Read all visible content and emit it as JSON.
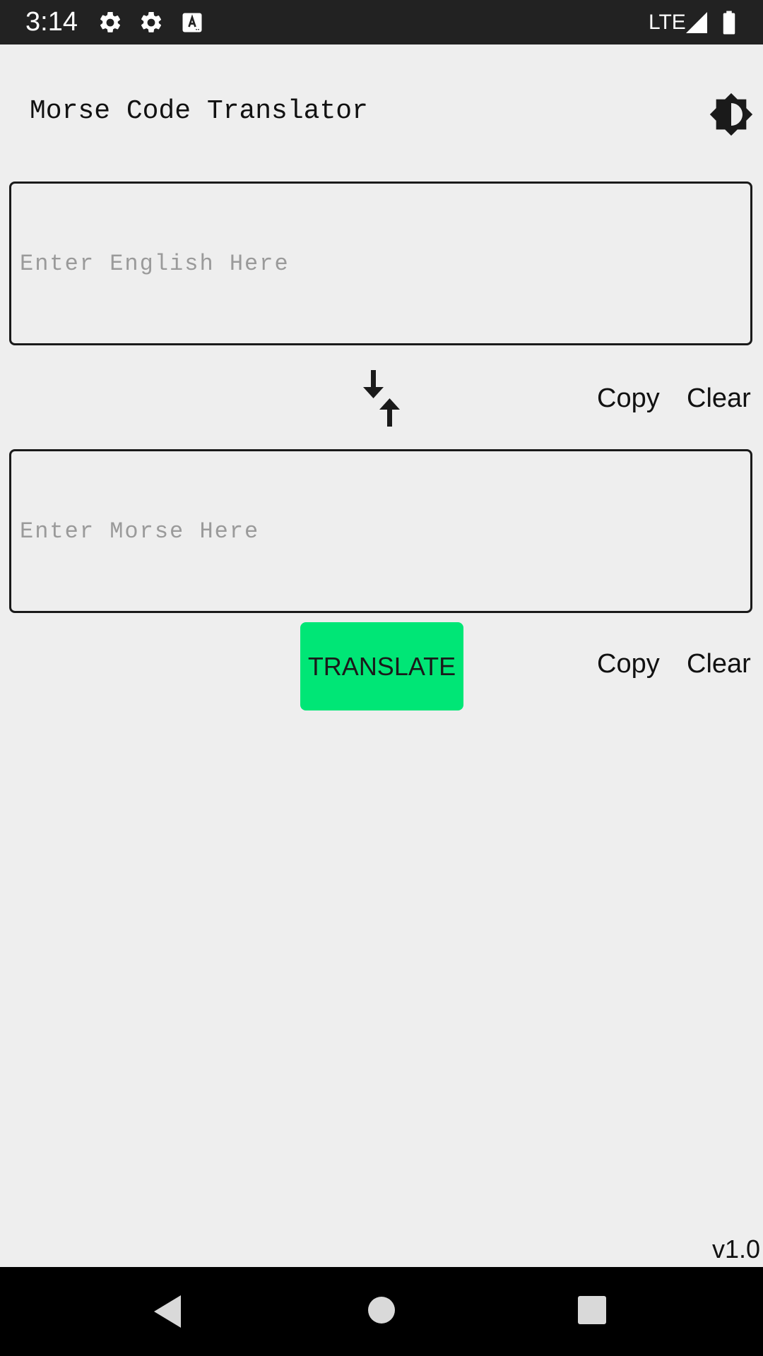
{
  "status_bar": {
    "time": "3:14",
    "network": "LTE",
    "icons": [
      "settings-icon",
      "settings-icon",
      "text-a-icon",
      "signal-icon",
      "battery-icon"
    ]
  },
  "app": {
    "title": "Morse Code Translator",
    "theme_icon": "brightness-icon"
  },
  "english": {
    "placeholder": "Enter English Here",
    "value": "",
    "copy_label": "Copy",
    "clear_label": "Clear"
  },
  "swap_icon": "swap-vertical-icon",
  "morse": {
    "placeholder": "Enter Morse Here",
    "value": "",
    "copy_label": "Copy",
    "clear_label": "Clear"
  },
  "translate_label": "TRANSLATE",
  "version": "v1.0",
  "colors": {
    "background": "#eeeeee",
    "accent": "#00e676",
    "status_bar": "#222222",
    "nav_bar": "#000000"
  },
  "nav": {
    "icons": [
      "back-icon",
      "home-icon",
      "recents-icon"
    ]
  }
}
